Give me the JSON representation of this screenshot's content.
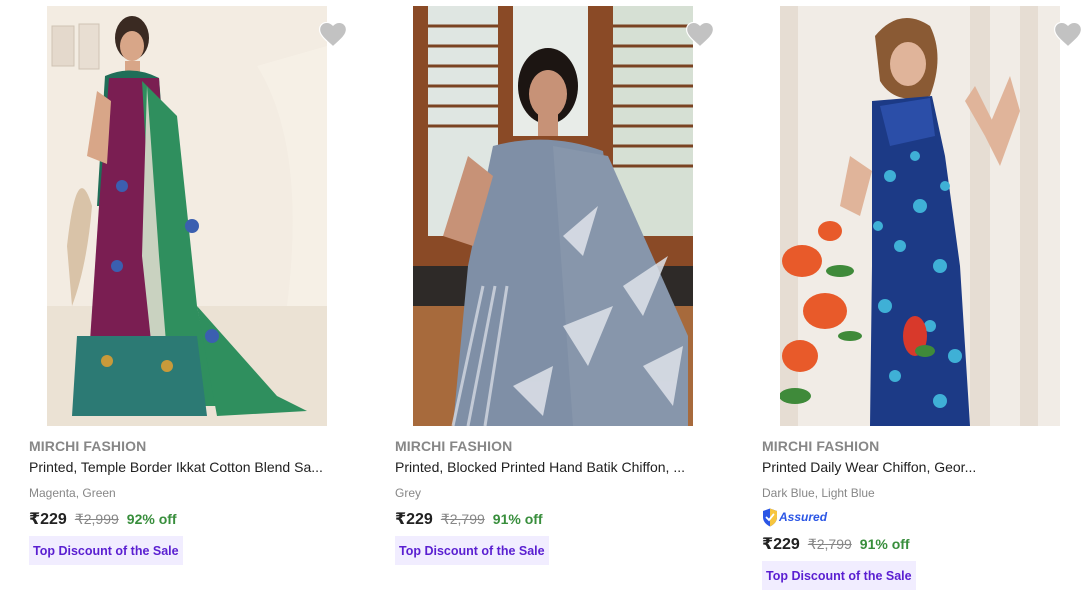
{
  "products": [
    {
      "brand": "MIRCHI FASHION",
      "title": "Printed, Temple Border Ikkat Cotton Blend Sa...",
      "color": "Magenta, Green",
      "assured": "",
      "price": "₹229",
      "mrp": "₹2,999",
      "off": "92% off",
      "tag": "Top Discount of the Sale",
      "wishlist_icon": "heart-icon",
      "image": "saree-magenta-green"
    },
    {
      "brand": "MIRCHI FASHION",
      "title": "Printed, Blocked Printed Hand Batik Chiffon, ...",
      "color": "Grey",
      "assured": "",
      "price": "₹229",
      "mrp": "₹2,799",
      "off": "91% off",
      "tag": "Top Discount of the Sale",
      "wishlist_icon": "heart-icon",
      "image": "saree-grey"
    },
    {
      "brand": "MIRCHI FASHION",
      "title": "Printed Daily Wear Chiffon, Geor...",
      "color": "Dark Blue, Light Blue",
      "assured": "Assured",
      "price": "₹229",
      "mrp": "₹2,799",
      "off": "91% off",
      "tag": "Top Discount of the Sale",
      "wishlist_icon": "heart-icon",
      "image": "saree-dark-blue"
    }
  ],
  "colors": {
    "brand_text": "#878787",
    "discount_green": "#388e3c",
    "tag_bg": "#f1edff",
    "tag_text": "#5a1fd1",
    "assured_blue": "#2a55e5",
    "heart_grey": "#c2c2c2"
  }
}
